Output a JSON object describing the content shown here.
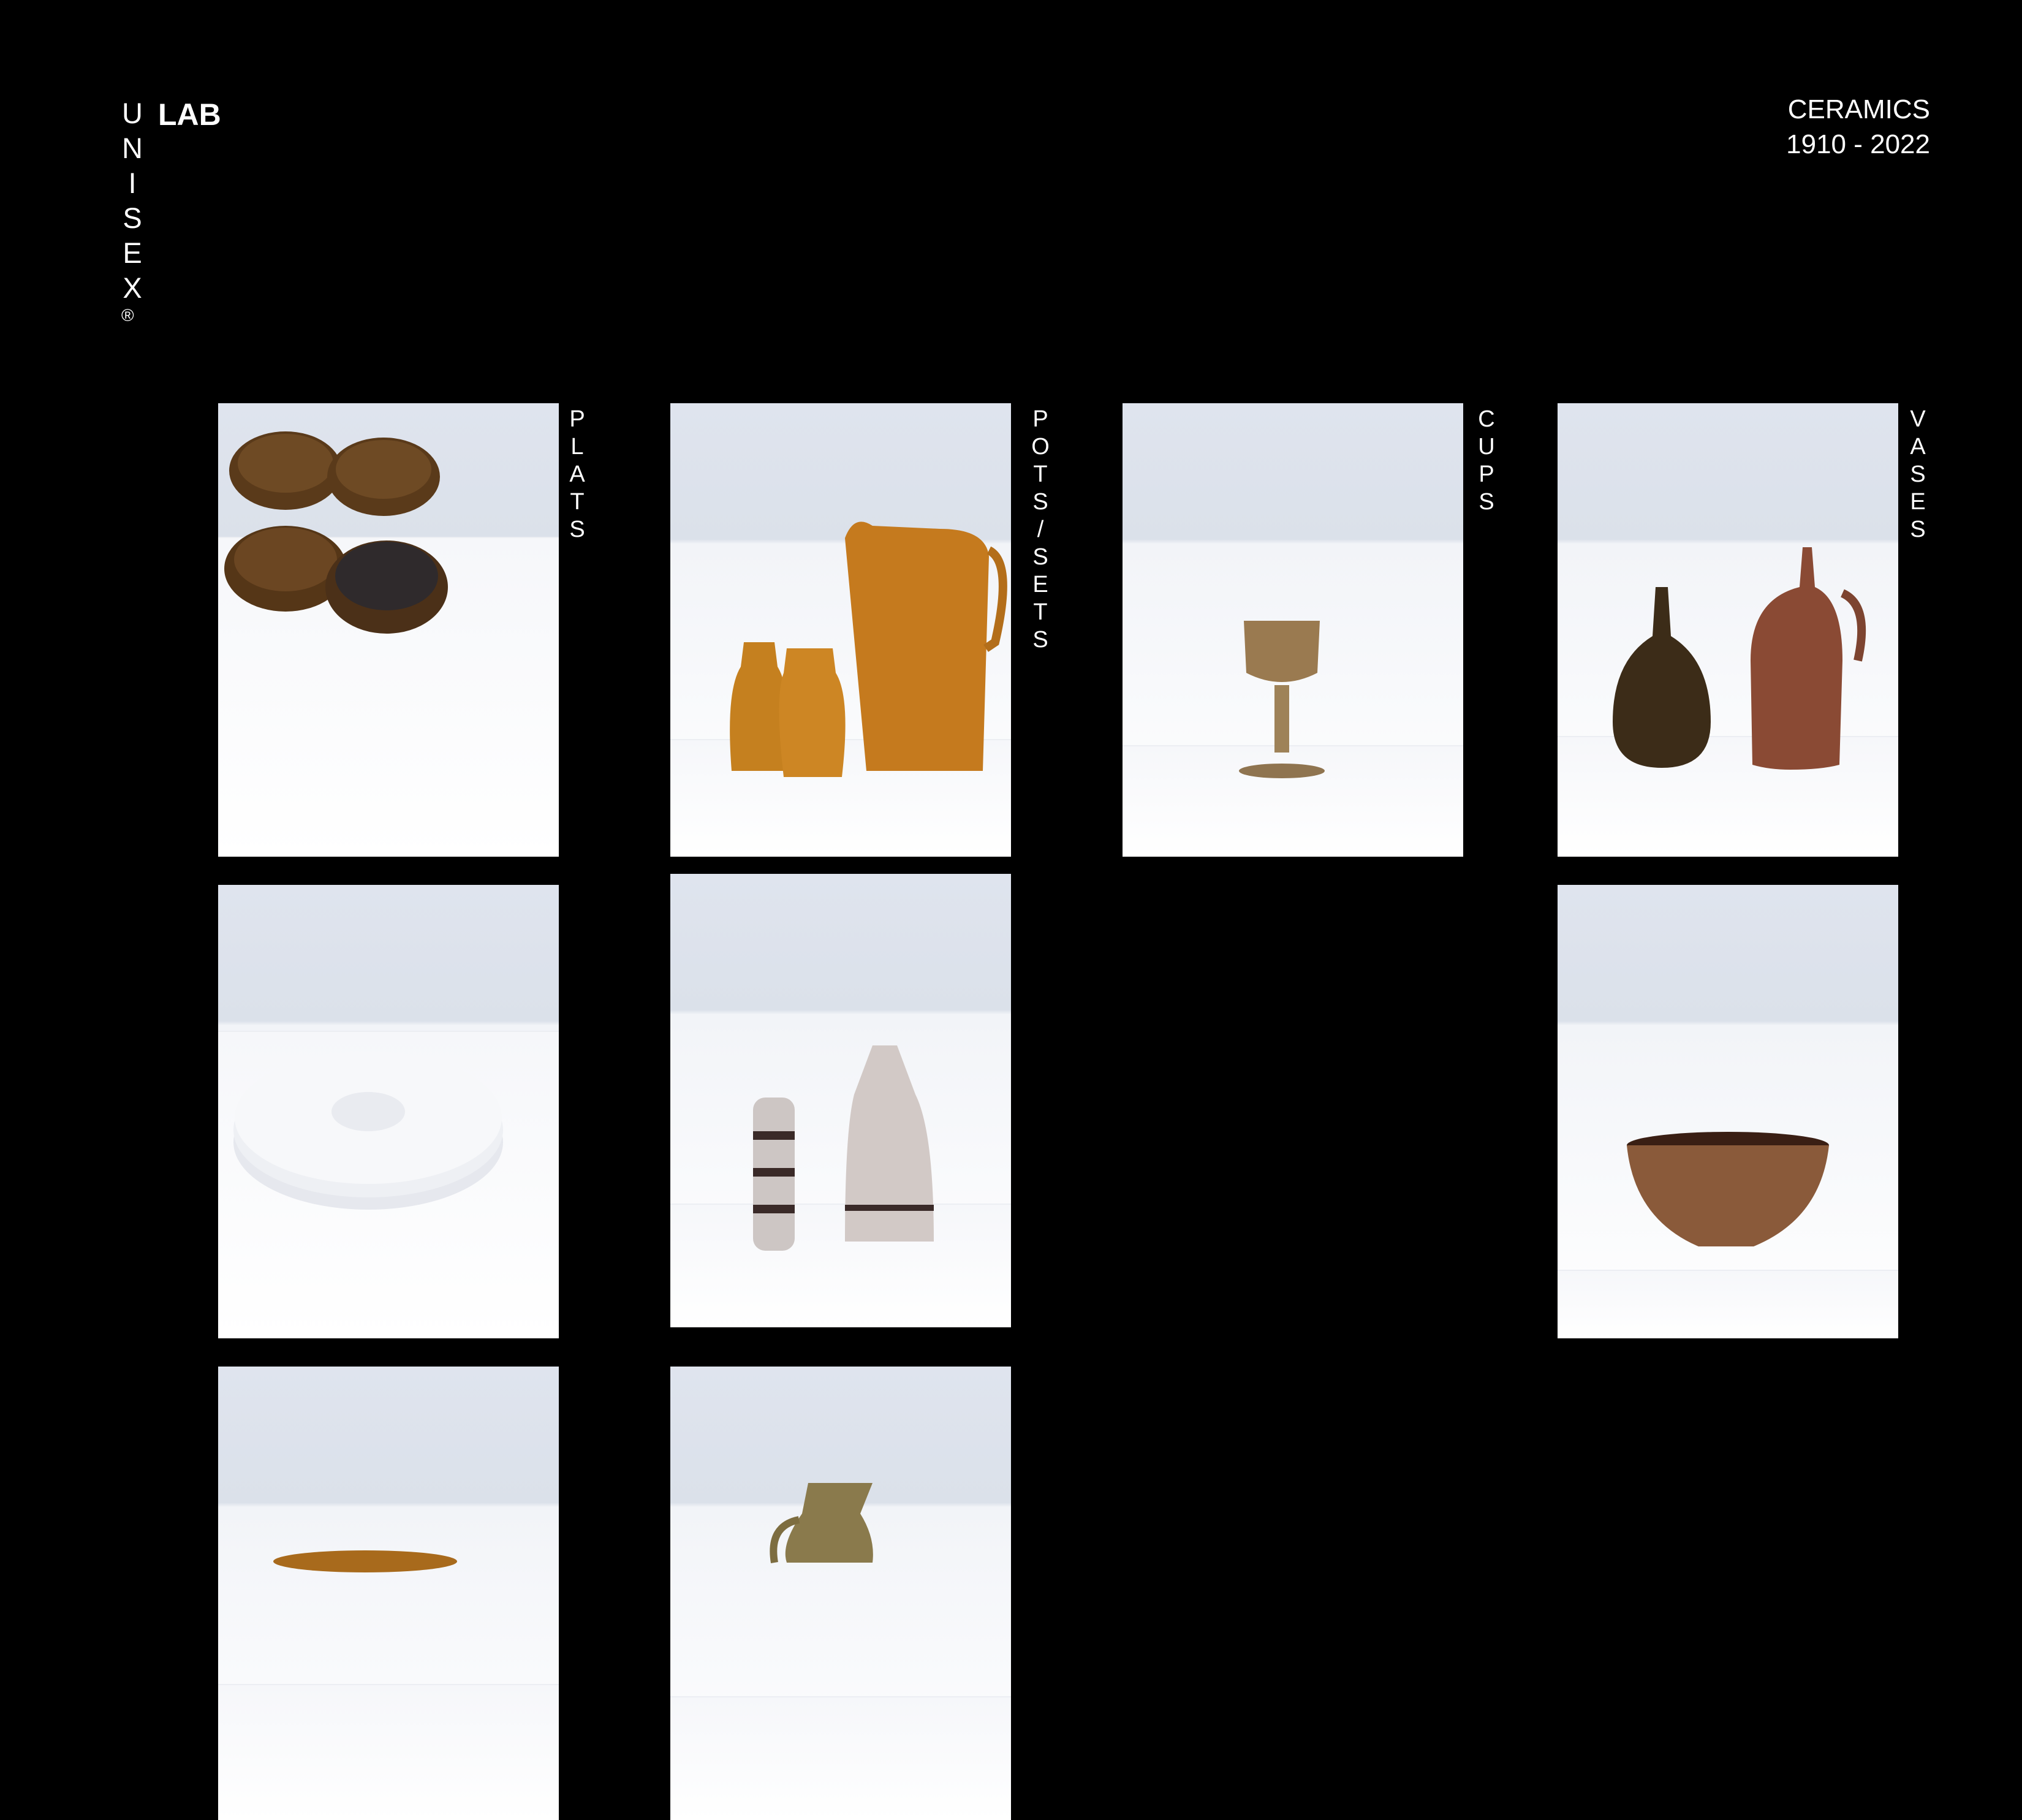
{
  "brand": {
    "vertical": "UNISEX",
    "mark": "®",
    "lab": "LAB"
  },
  "collection": {
    "title": "CERAMICS",
    "years": "1910 - 2022"
  },
  "categories": [
    {
      "label": "PLATS"
    },
    {
      "label": "POTS / SETS"
    },
    {
      "label": "CUPS"
    },
    {
      "label": "VASES"
    }
  ],
  "colors": {
    "background": "#000000",
    "text": "#ffffff",
    "backdrop": "#dfe4ee"
  }
}
